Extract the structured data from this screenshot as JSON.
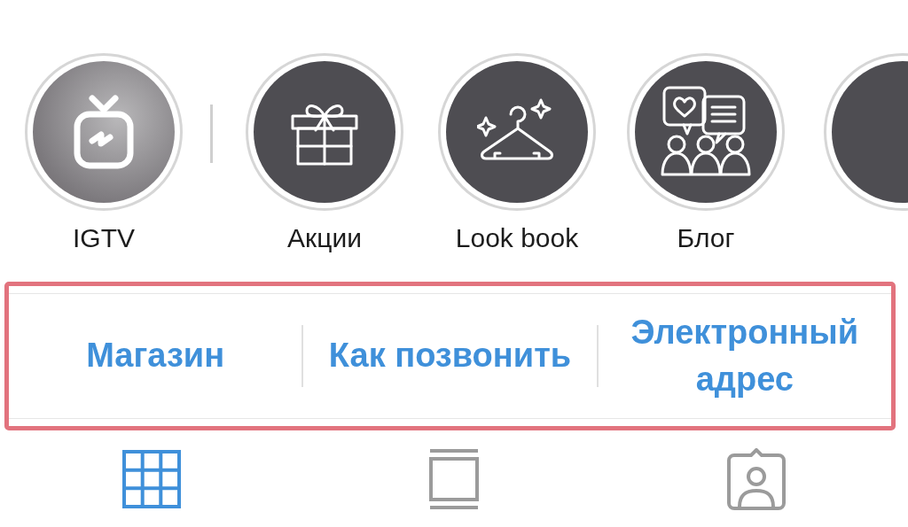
{
  "highlights": [
    {
      "label": "IGTV",
      "kind": "igtv"
    },
    {
      "label": "Акции",
      "kind": "gift"
    },
    {
      "label": "Look book",
      "kind": "hanger"
    },
    {
      "label": "Блог",
      "kind": "chat"
    },
    {
      "kind": "partial"
    }
  ],
  "action_bar": {
    "highlighted": true,
    "buttons": [
      "Магазин",
      "Как позвонить",
      "Электронный адрес"
    ]
  },
  "tabs": [
    {
      "kind": "grid",
      "selected": true
    },
    {
      "kind": "feed",
      "selected": false
    },
    {
      "kind": "tagged",
      "selected": false
    }
  ]
}
